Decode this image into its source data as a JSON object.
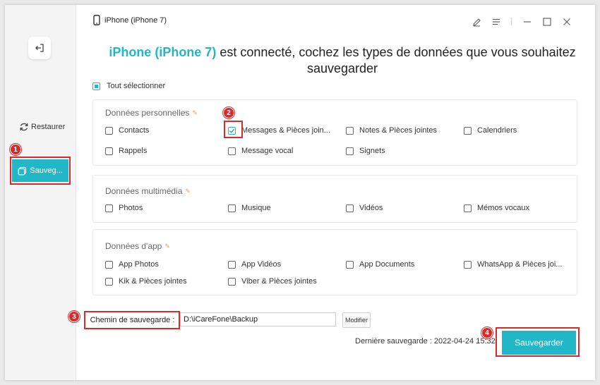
{
  "window": {
    "device_title": "iPhone (iPhone 7)"
  },
  "sidebar": {
    "restore_label": "Restaurer",
    "backup_label": "Sauveg..."
  },
  "heading": {
    "device": "iPhone (iPhone 7)",
    "text": " est connecté, cochez les types de données que vous souhaitez sauvegarder"
  },
  "select_all": {
    "label": "Tout sélectionner",
    "state": "partial"
  },
  "sections": {
    "personal": {
      "title": "Données personnelles",
      "items": [
        {
          "label": "Contacts",
          "checked": false
        },
        {
          "label": "Messages & Pièces join...",
          "checked": true
        },
        {
          "label": "Notes & Pièces jointes",
          "checked": false
        },
        {
          "label": "Calendriers",
          "checked": false
        },
        {
          "label": "Rappels",
          "checked": false
        },
        {
          "label": "Message vocal",
          "checked": false
        },
        {
          "label": "Signets",
          "checked": false
        }
      ]
    },
    "media": {
      "title": "Données multimédia",
      "items": [
        {
          "label": "Photos",
          "checked": false
        },
        {
          "label": "Musique",
          "checked": false
        },
        {
          "label": "Vidéos",
          "checked": false
        },
        {
          "label": "Mémos vocaux",
          "checked": false
        }
      ]
    },
    "app": {
      "title": "Données d'app",
      "items": [
        {
          "label": "App Photos",
          "checked": false
        },
        {
          "label": "App Vidéos",
          "checked": false
        },
        {
          "label": "App Documents",
          "checked": false
        },
        {
          "label": "WhatsApp & Pièces joi...",
          "checked": false
        },
        {
          "label": "Kik & Pièces jointes",
          "checked": false
        },
        {
          "label": "Viber & Pièces jointes",
          "checked": false
        }
      ]
    }
  },
  "path": {
    "label": "Chemin de sauvegarde :",
    "value": "D:\\iCareFone\\Backup",
    "modify_label": "Modifier"
  },
  "footer": {
    "last_backup": "Dernière sauvegarde : 2022-04-24 15:32",
    "save_label": "Sauvegarder"
  },
  "annotations": [
    "1",
    "2",
    "3",
    "4"
  ],
  "colors": {
    "accent": "#21b7c6",
    "annotation": "#d72b2b",
    "pencil": "#e59a5a"
  },
  "icons": {
    "back": "sign-out-icon",
    "restore": "refresh-icon",
    "backup": "copy-icon",
    "device": "phone-icon",
    "edit": "pencil-icon",
    "menu": "menu-icon",
    "minimize": "minimize-icon",
    "maximize": "maximize-icon",
    "close": "close-icon"
  }
}
